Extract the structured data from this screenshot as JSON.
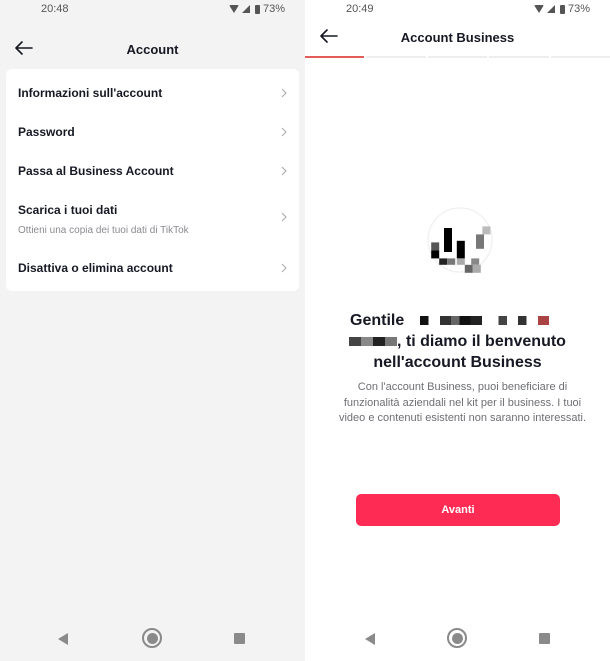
{
  "left_screen": {
    "status_bar": {
      "time": "20:48",
      "battery": "73%",
      "icons": [
        "wifi-icon",
        "signal-icon",
        "battery-icon"
      ]
    },
    "header": {
      "title": "Account",
      "back_icon": "arrow-left-icon"
    },
    "menu": [
      {
        "label": "Informazioni sull'account",
        "subtitle": null
      },
      {
        "label": "Password",
        "subtitle": null
      },
      {
        "label": "Passa al Business Account",
        "subtitle": null
      },
      {
        "label": "Scarica i tuoi dati",
        "subtitle": "Ottieni una copia dei tuoi dati di TikTok"
      },
      {
        "label": "Disattiva o elimina account",
        "subtitle": null
      }
    ],
    "nav_bar": [
      "back-triangle-icon",
      "home-circle-icon",
      "recent-square-icon"
    ]
  },
  "right_screen": {
    "status_bar": {
      "time": "20:49",
      "battery": "73%",
      "icons": [
        "wifi-icon",
        "signal-icon",
        "battery-icon"
      ]
    },
    "header": {
      "title": "Account Business",
      "back_icon": "arrow-left-icon"
    },
    "progress": {
      "steps": 5,
      "current": 1,
      "active_color": "#e25d58"
    },
    "welcome": {
      "greeting": "Gentile",
      "line2_suffix": ", ti diamo il benvenuto",
      "line3": "nell'account Business",
      "description": "Con l'account Business, puoi beneficiare di funzionalità aziendali nel kit per il business. I tuoi video e contenuti esistenti non saranno interessati."
    },
    "cta": {
      "label": "Avanti",
      "color": "#fe2c55"
    },
    "nav_bar": [
      "back-triangle-icon",
      "home-circle-icon",
      "recent-square-icon"
    ]
  }
}
